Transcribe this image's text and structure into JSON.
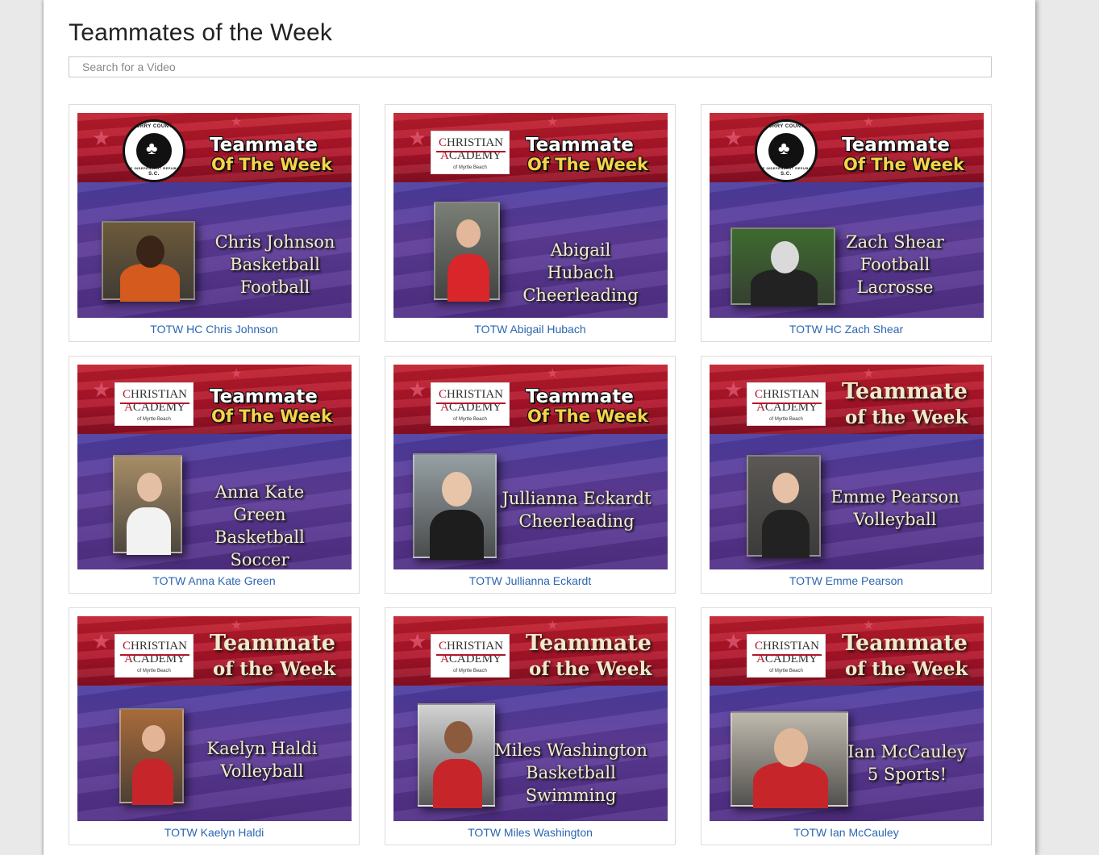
{
  "page": {
    "title": "Teammates of the Week",
    "search_placeholder": "Search for a Video"
  },
  "colors": {
    "link": "#2b66b1",
    "banner_red": "#b1142a",
    "field_purple": "#4a3ea3"
  },
  "videos": [
    {
      "caption": "TOTW HC Chris Johnson",
      "logo": "horry-county-seal",
      "seal_top": "HORRY COUNTY",
      "seal_mid": "THE INDEPENDENT REPUBLIC",
      "seal_bottom": "S.C.",
      "banner_line1": "Teammate",
      "banner_line2": "Of The Week",
      "player_lines": [
        "Chris Johnson",
        "Basketball",
        "Football"
      ]
    },
    {
      "caption": "TOTW Abigail Hubach",
      "logo": "christian-academy",
      "banner_line1": "Teammate",
      "banner_line2": "Of The Week",
      "player_lines": [
        "Abigail Hubach",
        "Cheerleading"
      ]
    },
    {
      "caption": "TOTW HC Zach Shear",
      "logo": "horry-county-seal",
      "seal_top": "HORRY COUNTY",
      "seal_mid": "THE INDEPENDENT REPUBLIC",
      "seal_bottom": "S.C.",
      "banner_line1": "Teammate",
      "banner_line2": "Of The Week",
      "player_lines": [
        "Zach Shear",
        "Football",
        "Lacrosse"
      ]
    },
    {
      "caption": "TOTW Anna Kate Green",
      "logo": "christian-academy",
      "banner_line1": "Teammate",
      "banner_line2": "Of The Week",
      "player_lines": [
        "Anna Kate Green",
        "Basketball",
        "Soccer"
      ]
    },
    {
      "caption": "TOTW Jullianna Eckardt",
      "logo": "christian-academy",
      "banner_line1": "Teammate",
      "banner_line2": "Of The Week",
      "player_lines": [
        "Jullianna Eckardt",
        "Cheerleading"
      ]
    },
    {
      "caption": "TOTW Emme Pearson",
      "logo": "christian-academy",
      "banner_line1": "Teammate",
      "banner_line2": "of the Week",
      "player_lines": [
        "Emme Pearson",
        "Volleyball"
      ]
    },
    {
      "caption": "TOTW Kaelyn Haldi",
      "logo": "christian-academy",
      "banner_line1": "Teammate",
      "banner_line2": "of the Week",
      "player_lines": [
        "Kaelyn Haldi",
        "Volleyball"
      ]
    },
    {
      "caption": "TOTW Miles Washington",
      "logo": "christian-academy",
      "banner_line1": "Teammate",
      "banner_line2": "of the Week",
      "player_lines": [
        "Miles Washington",
        "Basketball",
        "Swimming"
      ]
    },
    {
      "caption": "TOTW Ian McCauley",
      "logo": "christian-academy",
      "banner_line1": "Teammate",
      "banner_line2": "of the Week",
      "player_lines": [
        "Ian McCauley",
        "5 Sports!"
      ]
    }
  ],
  "academy_logo": {
    "line1_initial": "C",
    "line1_rest": "HRISTIAN",
    "line2_initial": "A",
    "line2_rest": "CADEMY",
    "sub": "of Myrtle Beach"
  }
}
